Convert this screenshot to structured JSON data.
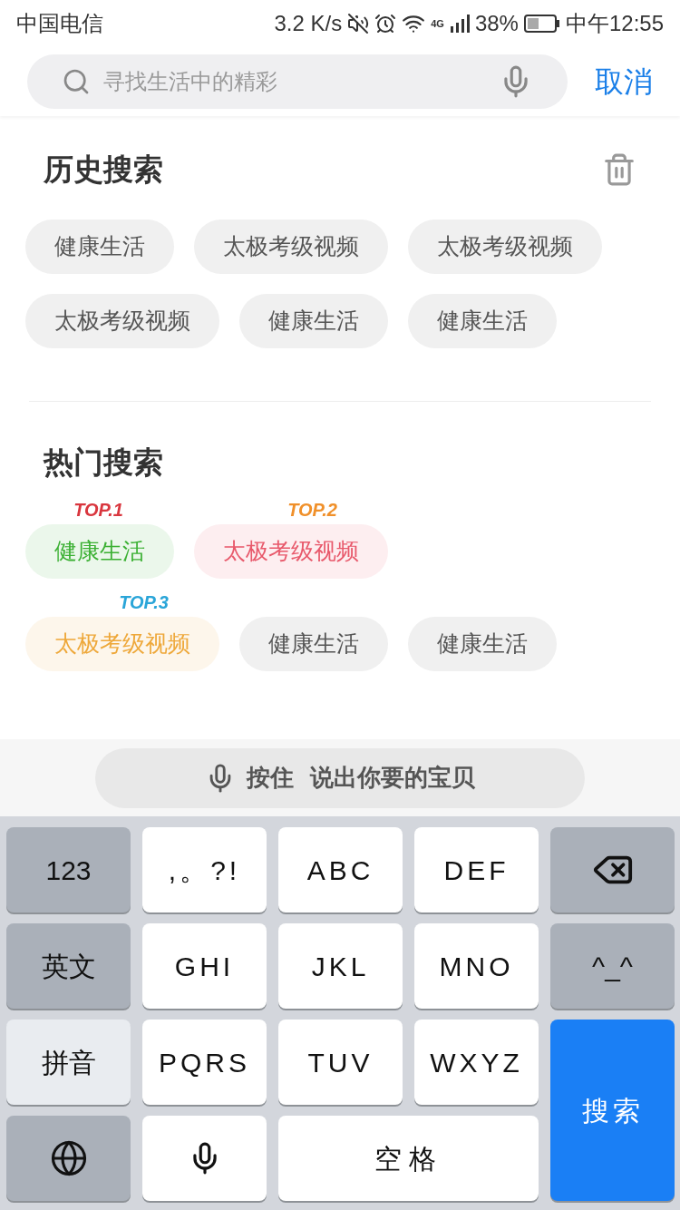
{
  "status_bar": {
    "carrier": "中国电信",
    "speed": "3.2 K/s",
    "network": "4G",
    "battery": "38%",
    "time": "中午12:55"
  },
  "search": {
    "placeholder": "寻找生活中的精彩",
    "cancel": "取消"
  },
  "history": {
    "title": "历史搜索",
    "items": [
      "健康生活",
      "太极考级视频",
      "太极考级视频",
      "太极考级视频",
      "健康生活",
      "健康生活"
    ]
  },
  "hot": {
    "title": "热门搜索",
    "rows": [
      [
        {
          "label": "健康生活",
          "color": "#3bb033",
          "badge": {
            "text": "TOP.1",
            "color": "#d9363e"
          }
        },
        {
          "label": "太极考级视频",
          "color": "#e8596b",
          "badge": {
            "text": "TOP.2",
            "color": "#f0902a"
          }
        }
      ],
      [
        {
          "label": "太极考级视频",
          "color": "#eea83a",
          "badge": {
            "text": "TOP.3",
            "color": "#2aa5d8"
          }
        },
        {
          "label": "健康生活"
        },
        {
          "label": "健康生活"
        }
      ]
    ]
  },
  "voice_bar": {
    "hold": "按住",
    "prompt": "说出你要的宝贝"
  },
  "keyboard": {
    "keys": [
      {
        "kind": "function",
        "label": "123"
      },
      {
        "kind": "char",
        "label": ",。?!"
      },
      {
        "kind": "char",
        "label": "ABC"
      },
      {
        "kind": "char",
        "label": "DEF"
      },
      {
        "kind": "delete"
      },
      {
        "kind": "function",
        "label": "英文"
      },
      {
        "kind": "char",
        "label": "GHI"
      },
      {
        "kind": "char",
        "label": "JKL"
      },
      {
        "kind": "char",
        "label": "MNO"
      },
      {
        "kind": "function",
        "label": "^_^"
      },
      {
        "kind": "mode",
        "label": "拼音"
      },
      {
        "kind": "char",
        "label": "PQRS"
      },
      {
        "kind": "char",
        "label": "TUV"
      },
      {
        "kind": "char",
        "label": "WXYZ"
      },
      {
        "kind": "search",
        "label": "搜索"
      },
      {
        "kind": "globe"
      },
      {
        "kind": "voice"
      },
      {
        "kind": "space",
        "label": "空格"
      }
    ]
  }
}
